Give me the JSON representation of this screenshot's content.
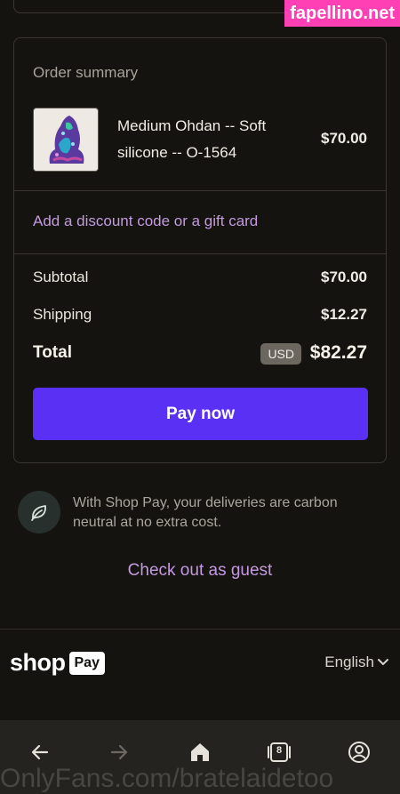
{
  "watermarks": {
    "top": "fapellino.net",
    "bottom": "OnlyFans.com/bratelaidetoo"
  },
  "order_summary": {
    "title": "Order summary",
    "item": {
      "name_line1": "Medium Ohdan -- Soft",
      "name_line2": "silicone -- O-1564",
      "price": "$70.00"
    },
    "discount_link": "Add a discount code or a gift card",
    "subtotal": {
      "label": "Subtotal",
      "value": "$70.00"
    },
    "shipping": {
      "label": "Shipping",
      "value": "$12.27"
    },
    "total": {
      "label": "Total",
      "currency": "USD",
      "value": "$82.27"
    },
    "pay_button": "Pay now"
  },
  "carbon_notice": "With Shop Pay, your deliveries are carbon neutral at no extra cost.",
  "guest_link": "Check out as guest",
  "footer": {
    "logo_shop": "shop",
    "logo_pay": "Pay",
    "language": "English"
  },
  "browser_nav": {
    "tab_count": "8",
    "icons": [
      "back-icon",
      "forward-icon",
      "home-icon",
      "tabs-icon",
      "profile-icon"
    ]
  },
  "colors": {
    "background": "#15130f",
    "accent_purple": "#5a31f4",
    "link": "#c39ae0",
    "watermark": "#ff3fb4"
  }
}
